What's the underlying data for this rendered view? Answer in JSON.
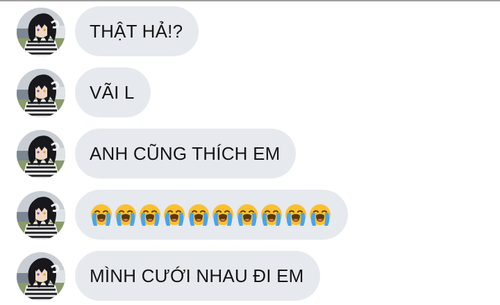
{
  "messages": [
    {
      "text": "THẬT HẢ!?"
    },
    {
      "text": "VÃI L"
    },
    {
      "text": "ANH CŨNG THÍCH EM"
    },
    {
      "emoji": "loudly-crying-face",
      "count": 10
    },
    {
      "text": "MÌNH CƯỚI NHAU ĐI EM"
    }
  ],
  "colors": {
    "bubble": "#e6e9ee",
    "text": "#141414",
    "emoji_face": "#fbc02d",
    "emoji_tears": "#42a5f5"
  }
}
